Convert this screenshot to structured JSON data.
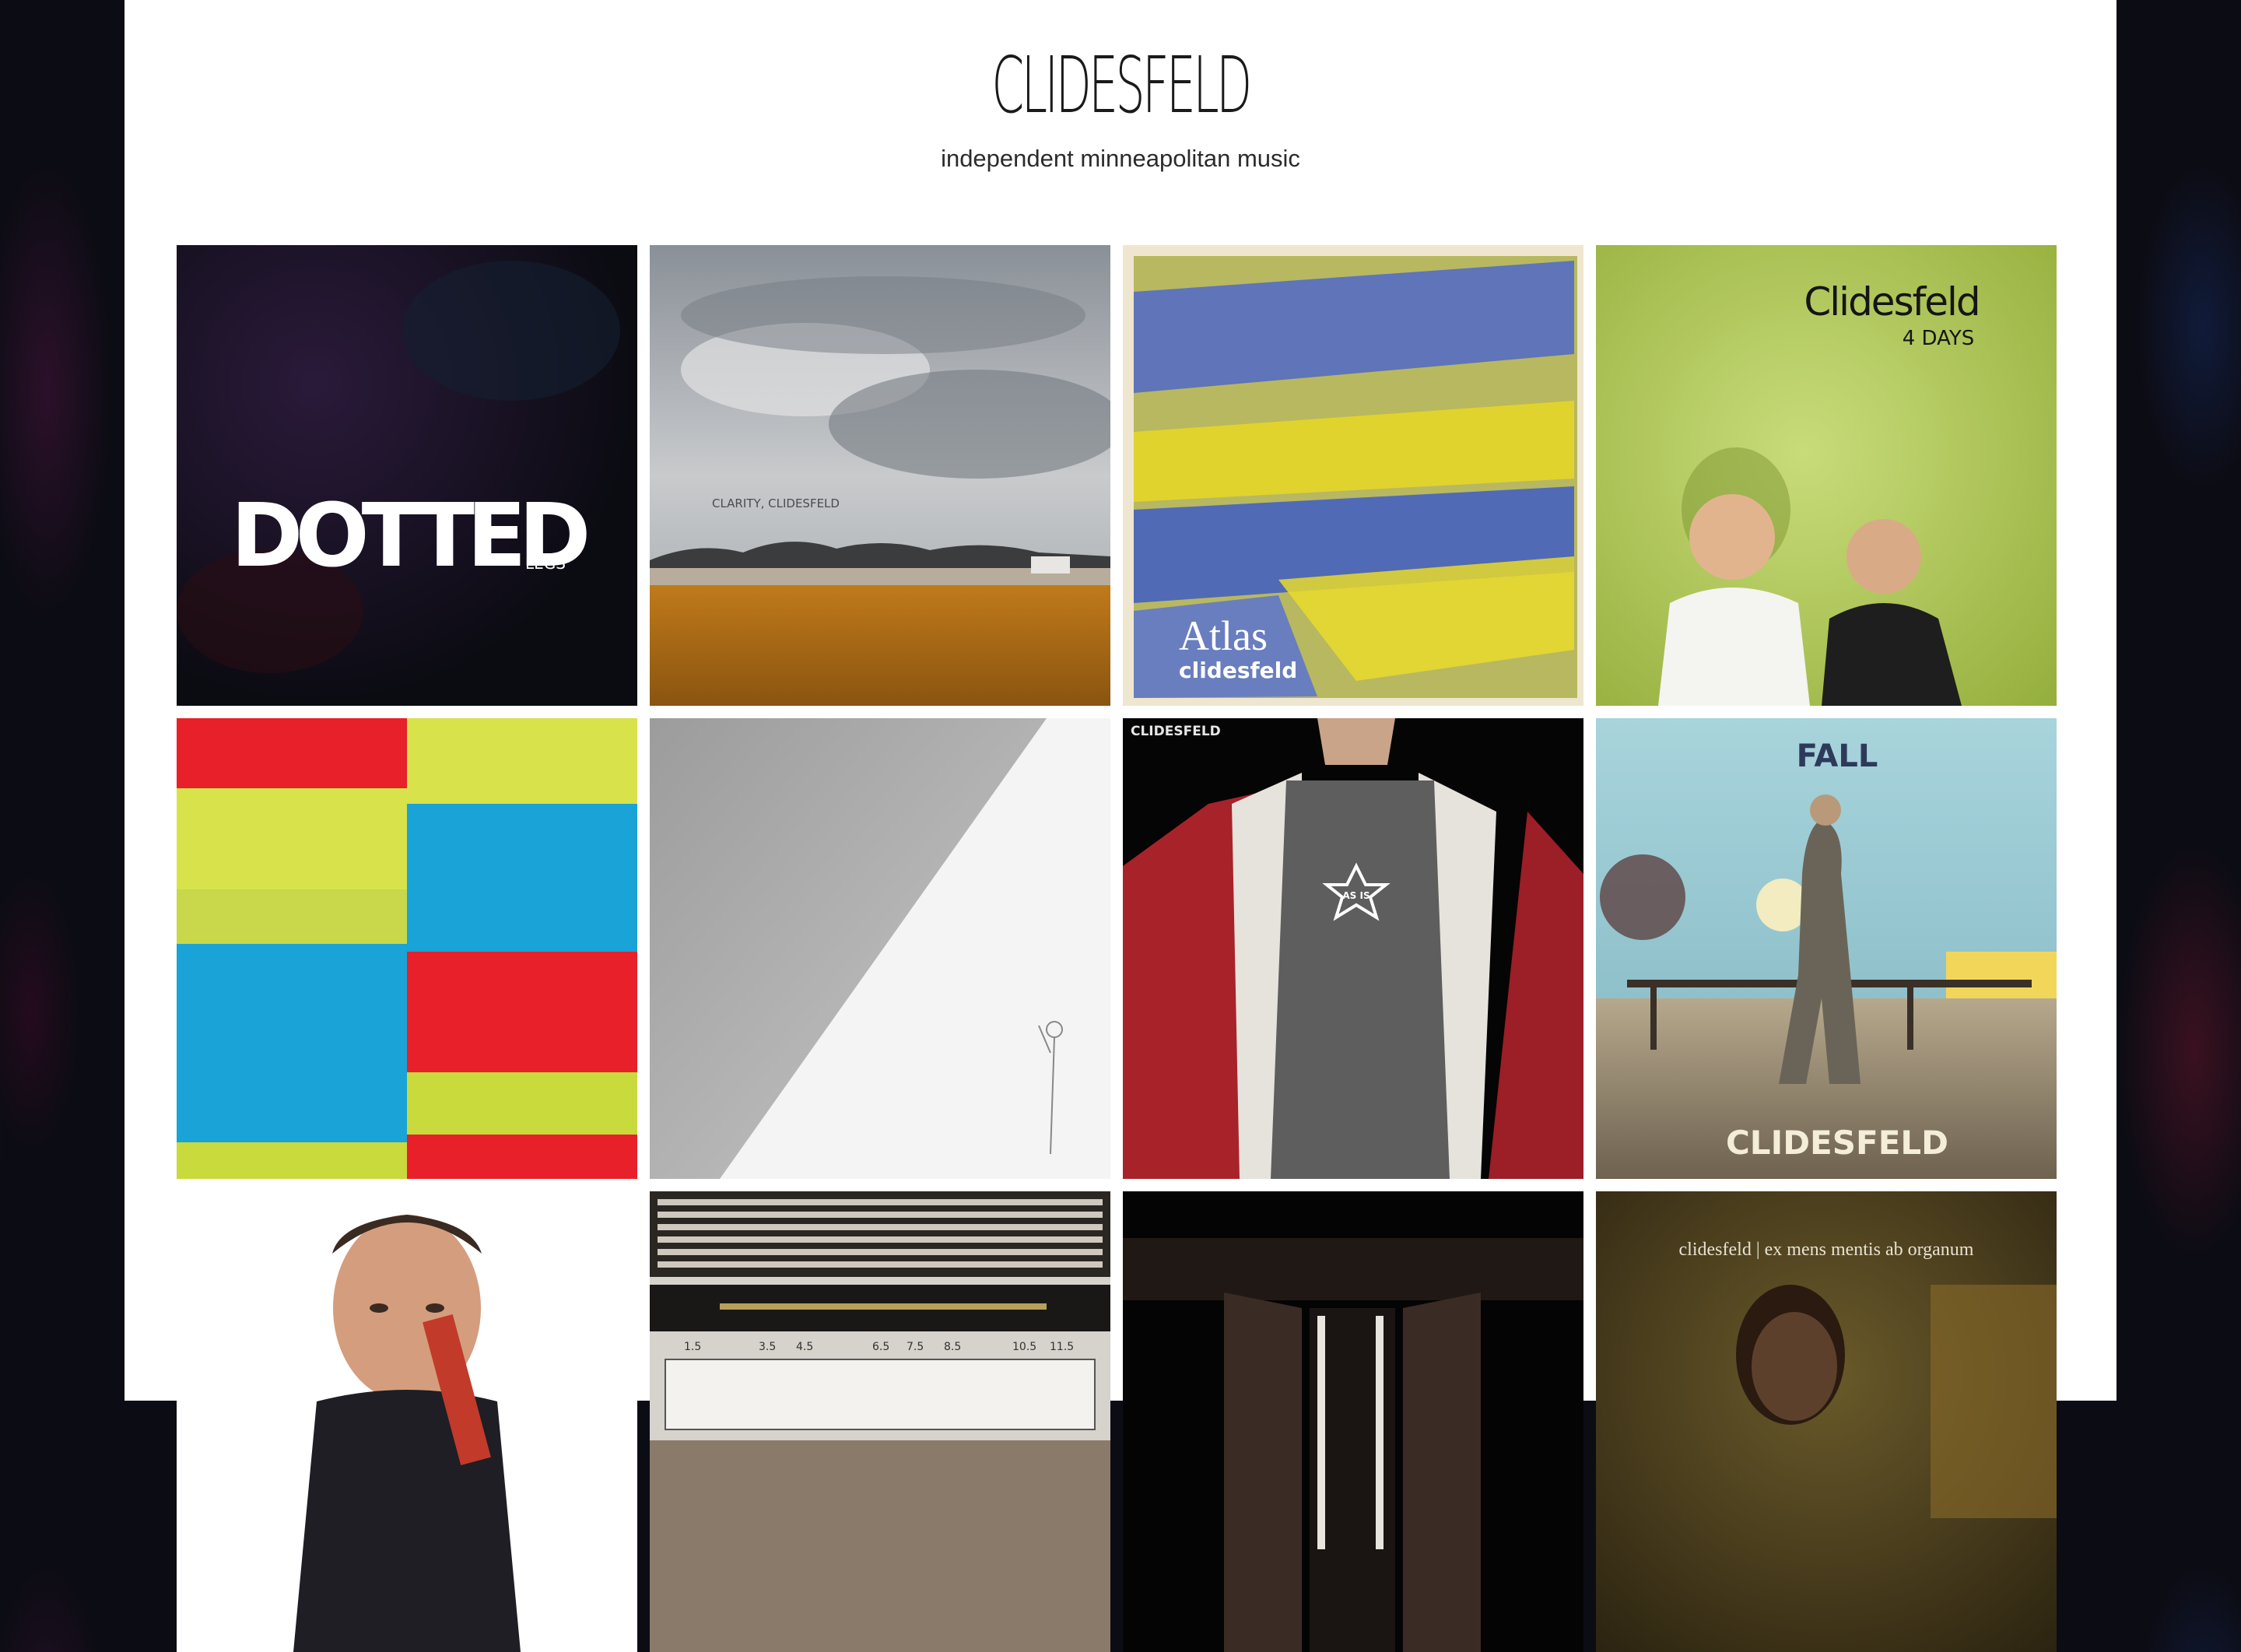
{
  "site": {
    "title": "CLIDESFELD",
    "tagline": "independent minneapolitan music"
  },
  "albums": [
    {
      "name": "Dotted Legs",
      "cover_text": [
        "DOTTED",
        "LEGS"
      ],
      "accent": "#101018"
    },
    {
      "name": "Clarity",
      "cover_text": [
        "CLARITY, CLIDESFELD"
      ],
      "accent": "#b46a0e"
    },
    {
      "name": "Atlas",
      "cover_text": [
        "Atlas",
        "clidesfeld"
      ],
      "accent": "#3a5fd0"
    },
    {
      "name": "4 Days",
      "cover_text": [
        "Clidesfeld",
        "4 DAYS"
      ],
      "accent": "#a8c24f"
    },
    {
      "name": "Color Blocks",
      "cover_text": [],
      "accent": "#e8202a"
    },
    {
      "name": "Grey Diagonal",
      "cover_text": [],
      "accent": "#bdbdbd"
    },
    {
      "name": "As Is",
      "cover_text": [
        "CLIDESFELD",
        "AS IS"
      ],
      "accent": "#5b5b5b"
    },
    {
      "name": "Fall",
      "cover_text": [
        "FALL",
        "CLIDESFELD"
      ],
      "accent": "#7fb7c7"
    },
    {
      "name": "Agent",
      "cover_text": [],
      "accent": "#c23a2a"
    },
    {
      "name": "Machine",
      "cover_text": [
        "1.5",
        "3.5",
        "4.5",
        "6.5",
        "7.5",
        "8.5",
        "10.5",
        "11.5"
      ],
      "accent": "#8a7a6a"
    },
    {
      "name": "Doorway",
      "cover_text": [],
      "accent": "#3a2c24"
    },
    {
      "name": "Ex Mens Mentis ab Organum",
      "cover_text": [
        "clidesfeld | ex mens mentis ab organum"
      ],
      "accent": "#4a3a1a"
    }
  ]
}
